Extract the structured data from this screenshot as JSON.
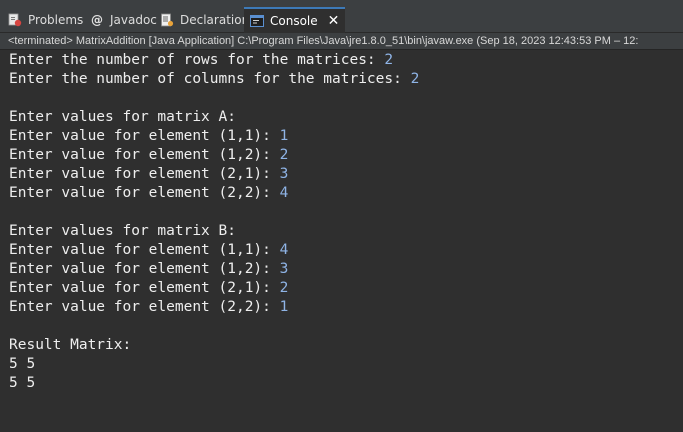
{
  "tabs": [
    {
      "label": "Problems",
      "icon": "problems-icon"
    },
    {
      "label": "Javadoc",
      "icon": "javadoc-icon"
    },
    {
      "label": "Declaration",
      "icon": "declaration-icon"
    },
    {
      "label": "Console",
      "icon": "console-icon",
      "active": true
    }
  ],
  "console": {
    "status": "<terminated> MatrixAddition [Java Application] C:\\Program Files\\Java\\jre1.8.0_51\\bin\\javaw.exe  (Sep 18, 2023 12:43:53 PM – 12:",
    "lines": [
      {
        "prompt": "Enter the number of rows for the matrices: ",
        "input": "2"
      },
      {
        "prompt": "Enter the number of columns for the matrices: ",
        "input": "2"
      },
      {
        "prompt": "Enter values for matrix A:",
        "input": ""
      },
      {
        "prompt": "Enter value for element (1,1): ",
        "input": "1"
      },
      {
        "prompt": "Enter value for element (1,2): ",
        "input": "2"
      },
      {
        "prompt": "Enter value for element (2,1): ",
        "input": "3"
      },
      {
        "prompt": "Enter value for element (2,2): ",
        "input": "4"
      },
      {
        "prompt": "Enter values for matrix B:",
        "input": ""
      },
      {
        "prompt": "Enter value for element (1,1): ",
        "input": "4"
      },
      {
        "prompt": "Enter value for element (1,2): ",
        "input": "3"
      },
      {
        "prompt": "Enter value for element (2,1): ",
        "input": "2"
      },
      {
        "prompt": "Enter value for element (2,2): ",
        "input": "1"
      },
      {
        "prompt": "Result Matrix:",
        "input": ""
      },
      {
        "prompt": "5 5",
        "input": ""
      },
      {
        "prompt": "5 5",
        "input": ""
      }
    ]
  },
  "colors": {
    "background": "#2f2f2f",
    "text": "#eeeeee",
    "user_input": "#8fb4e6",
    "active_tab_accent": "#3d7ab8"
  }
}
